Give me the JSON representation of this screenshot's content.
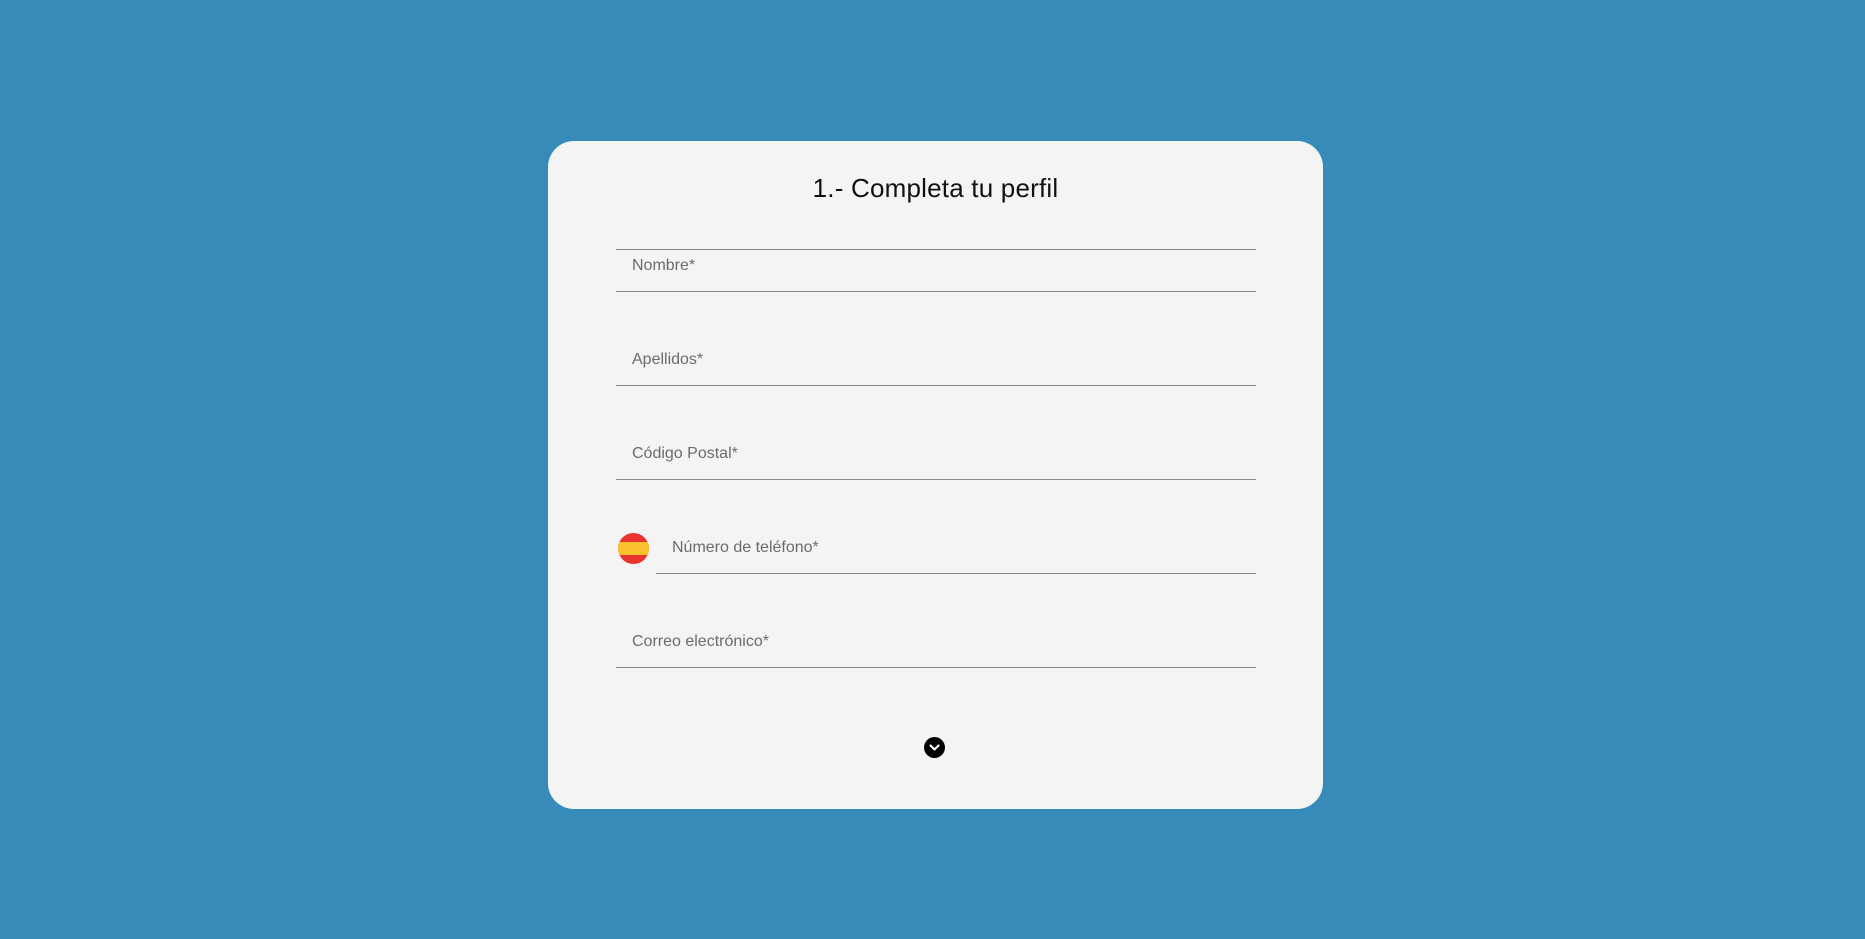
{
  "page": {
    "background_color": "#378bb9",
    "card_color": "#f4f4f4"
  },
  "form": {
    "title": "1.- Completa tu perfil",
    "fields": {
      "nombre": {
        "placeholder": "Nombre*",
        "value": ""
      },
      "apellidos": {
        "placeholder": "Apellidos*",
        "value": ""
      },
      "codigo_postal": {
        "placeholder": "Código Postal*",
        "value": ""
      },
      "telefono": {
        "placeholder": "Número de teléfono*",
        "value": "",
        "country_flag_icon": "spain-flag-icon"
      },
      "correo": {
        "placeholder": "Correo electrónico*",
        "value": ""
      }
    },
    "scroll_button": {
      "icon": "chevron-down-icon"
    }
  }
}
